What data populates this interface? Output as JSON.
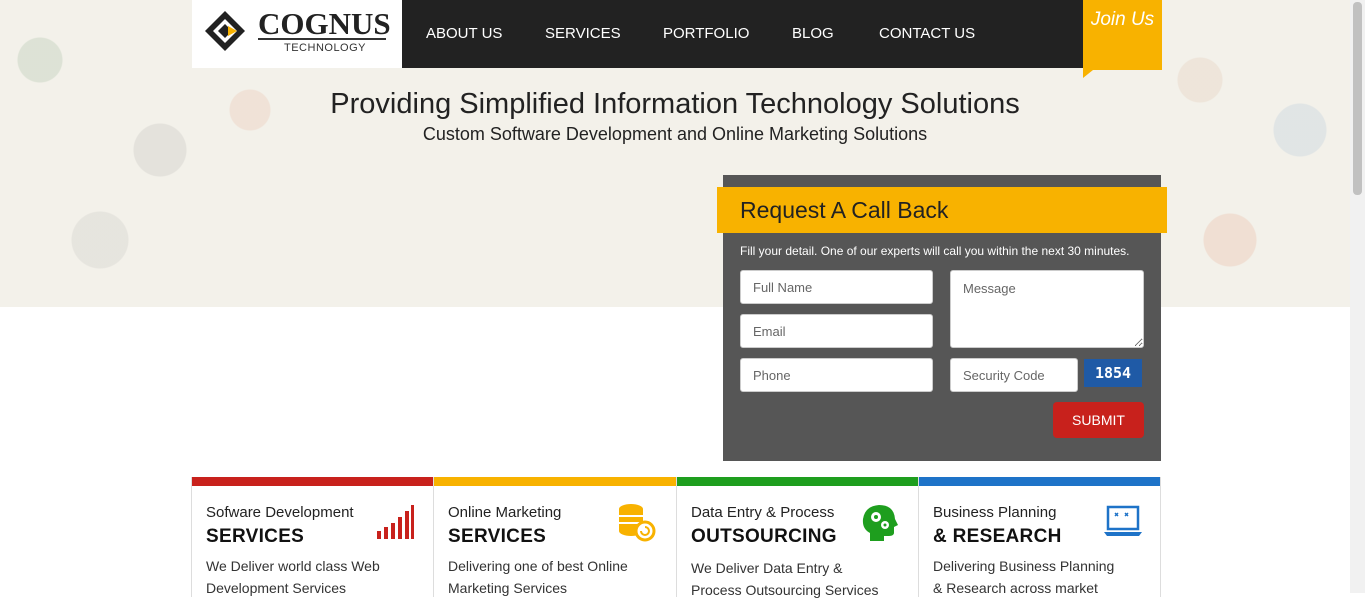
{
  "brand": {
    "name": "COGNUS",
    "tagline": "TECHNOLOGY"
  },
  "nav": {
    "items": [
      "ABOUT US",
      "SERVICES",
      "PORTFOLIO",
      "BLOG",
      "CONTACT US"
    ],
    "join_label": "Join Us"
  },
  "hero": {
    "title": "Providing Simplified Information Technology Solutions",
    "subtitle": "Custom Software Development and Online Marketing Solutions"
  },
  "callback_form": {
    "title": "Request A Call Back",
    "description": "Fill your detail. One of our experts will call you within the next 30 minutes.",
    "full_name_placeholder": "Full Name",
    "email_placeholder": "Email",
    "phone_placeholder": "Phone",
    "message_placeholder": "Message",
    "security_code_placeholder": "Security Code",
    "captcha_value": "1854",
    "submit_label": "SUBMIT"
  },
  "services": [
    {
      "line1": "Sofware Development",
      "line2": "SERVICES",
      "description": "We Deliver world class Web Development Services",
      "color": "#c8211c",
      "icon": "bar-chart-icon"
    },
    {
      "line1": "Online Marketing",
      "line2": "SERVICES",
      "description": "Delivering one of best Online Marketing Services",
      "color": "#f8b200",
      "icon": "coins-icon"
    },
    {
      "line1": "Data Entry & Process",
      "line2": "OUTSOURCING",
      "description": "We Deliver Data Entry & Process Outsourcing Services",
      "color": "#1e9e1e",
      "icon": "head-gears-icon"
    },
    {
      "line1": "Business Planning",
      "line2": "& RESEARCH",
      "description": "Delivering Business Planning & Research across market",
      "color": "#1e73c8",
      "icon": "laptop-icon"
    }
  ],
  "colors": {
    "accent": "#f8b200",
    "nav_bg": "#222222",
    "form_bg": "#565656",
    "submit": "#c8211c"
  }
}
